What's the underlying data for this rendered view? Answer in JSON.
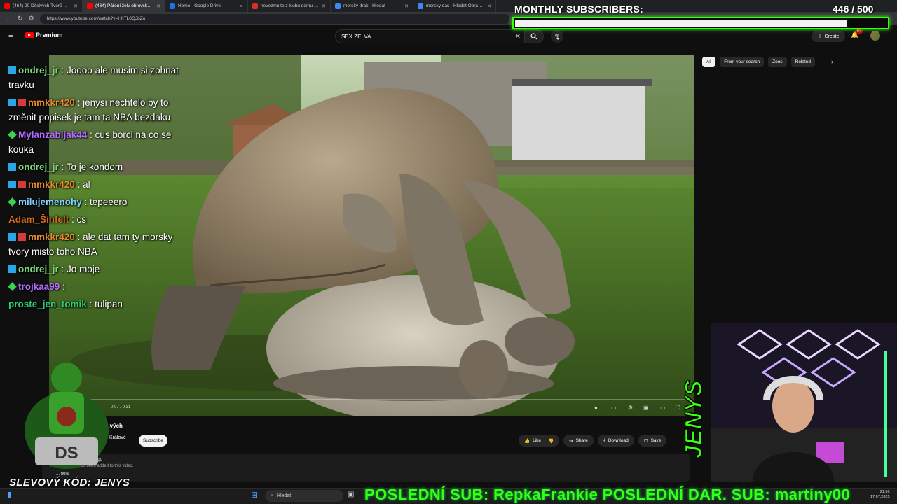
{
  "browser": {
    "tabs": [
      {
        "title": "(464) 20 Děsivých Tvorů Nalezených",
        "color": "#ff0000",
        "active": false
      },
      {
        "title": "(464) Páření želv obrovských",
        "color": "#ff0000",
        "active": true
      },
      {
        "title": "Home - Google Drive",
        "color": "#1a73e8",
        "active": false
      },
      {
        "title": "nevezmu te z klubu domu 3 resi",
        "color": "#d93025",
        "active": false
      },
      {
        "title": "morsky drak - Hledat",
        "color": "#4285f4",
        "active": false
      },
      {
        "title": "morsky das - Hledat Obrázky",
        "color": "#4285f4",
        "active": false
      }
    ],
    "url": "https://www.youtube.com/watch?v=HhTL0QJbZo"
  },
  "youtube": {
    "logo_label": "Premium",
    "search_value": "SEX ZELVA",
    "create_label": "Create",
    "notification_count": "9+",
    "chips": [
      "All",
      "From your search",
      "Zoos",
      "Related"
    ],
    "video": {
      "timecode": "0:07 / 0:31"
    },
    "channel_name": "...vých",
    "channel_sub": "Králové",
    "subscribe_label": "Subscribe",
    "actions": {
      "like": "Like",
      "share": "Share",
      "download": "Download",
      "save": "Save"
    },
    "description": {
      "ago": "ago",
      "text": "No description has been added to this video.",
      "more": "...more"
    }
  },
  "chat": [
    {
      "badges": [
        "blue"
      ],
      "user": "ondrej_jr",
      "color": "#7cd67c",
      "text": ": Joooo ale musim si zohnat travku"
    },
    {
      "badges": [
        "blue",
        "red"
      ],
      "user": "mmkkr420",
      "color": "#e68a2e",
      "text": ": jenysi nechtelo by to změnit popisek je tam ta NBA bezdaku"
    },
    {
      "badges": [
        "green"
      ],
      "user": "Mylanzabijak44",
      "color": "#b36bff",
      "text": ": cus borci na co se kouka"
    },
    {
      "badges": [
        "blue"
      ],
      "user": "ondrej_jr",
      "color": "#7cd67c",
      "text": ": To je kondom"
    },
    {
      "badges": [
        "blue",
        "red"
      ],
      "user": "mmkkr420",
      "color": "#e68a2e",
      "text": ": al"
    },
    {
      "badges": [
        "green"
      ],
      "user": "milujemenohy",
      "color": "#7fd0ff",
      "text": ": tepeeero"
    },
    {
      "badges": [],
      "user": "Adam_Šinfelt",
      "color": "#d2691e",
      "text": ": cs"
    },
    {
      "badges": [
        "blue",
        "red"
      ],
      "user": "mmkkr420",
      "color": "#e68a2e",
      "text": ": ale dat tam ty morsky tvory misto toho NBA"
    },
    {
      "badges": [
        "blue"
      ],
      "user": "ondrej_jr",
      "color": "#7cd67c",
      "text": ": Jo moje"
    },
    {
      "badges": [
        "green"
      ],
      "user": "trojkaa99",
      "color": "#b36bff",
      "text": ":"
    },
    {
      "badges": [],
      "user": "proste_jen_tomik",
      "color": "#2ecc71",
      "text": ": tulipan"
    }
  ],
  "overlay": {
    "subs_label": "MONTHLY SUBSCRIBERS:",
    "subs_value": "446 / 500",
    "subs_fraction": 0.892,
    "promo": "SLEVOVÝ KÓD: JENYS",
    "ticker": "POSLEDNÍ SUB: RepkaFrankie POSLEDNÍ DAR. SUB: martiny00",
    "cam_logo": "JENYS"
  },
  "taskbar": {
    "search_placeholder": "Hledat",
    "time": "21:50",
    "date": "17.07.2025"
  },
  "colors": {
    "accent_green": "#39ff14",
    "youtube_red": "#ff0000"
  }
}
